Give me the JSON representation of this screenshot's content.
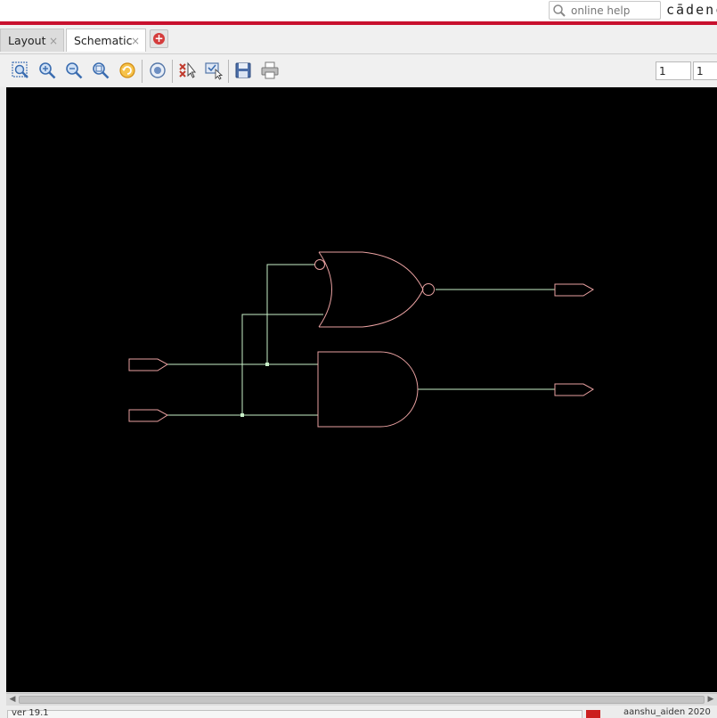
{
  "header": {
    "search_placeholder": "online help",
    "brand": "cādence",
    "accent_color": "#c8102e"
  },
  "tabs": [
    {
      "label": "Layout",
      "active": false
    },
    {
      "label": "Schematic",
      "active": true
    }
  ],
  "tab_close_glyph": "×",
  "tab_add_icon": "plus-circle-icon",
  "toolbar": {
    "icons": [
      "zoom-fit-icon",
      "zoom-in-icon",
      "zoom-out-icon",
      "zoom-area-icon",
      "refresh-icon",
      "select-icon",
      "deselect-icon",
      "filter-select-icon",
      "save-icon",
      "print-icon"
    ],
    "page_field_1": "1",
    "page_field_2": "1"
  },
  "schematic": {
    "background": "#000000",
    "gate_color": "#e8a0a0",
    "wire_color": "#c8f0c8",
    "components": [
      "nor-gate-with-inverted-input",
      "and-gate",
      "input-port-a",
      "input-port-b",
      "output-port-nor",
      "output-port-and"
    ]
  },
  "statusbar": {
    "left_text": "ver 19.1",
    "right_text": "aanshu_aiden 2020"
  }
}
